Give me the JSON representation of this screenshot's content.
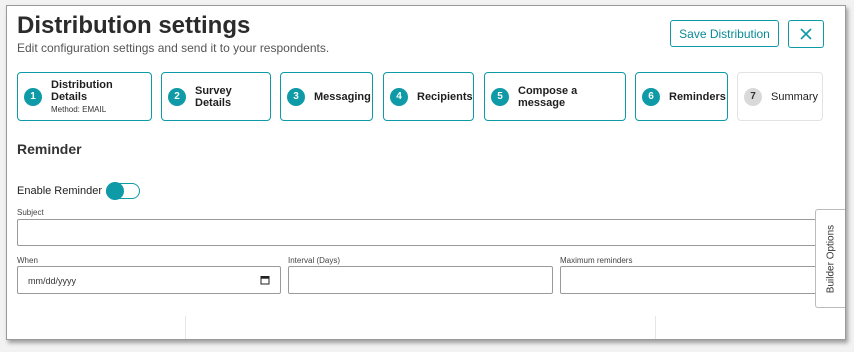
{
  "header": {
    "title": "Distribution settings",
    "subtitle": "Edit configuration settings and send it to your respondents.",
    "save_label": "Save Distribution"
  },
  "steps": [
    {
      "num": "1",
      "label": "Distribution Details",
      "sub": "Method: EMAIL"
    },
    {
      "num": "2",
      "label": "Survey Details"
    },
    {
      "num": "3",
      "label": "Messaging"
    },
    {
      "num": "4",
      "label": "Recipients"
    },
    {
      "num": "5",
      "label": "Compose a message"
    },
    {
      "num": "6",
      "label": "Reminders"
    },
    {
      "num": "7",
      "label": "Summary"
    }
  ],
  "reminder": {
    "section_title": "Reminder",
    "enable_label": "Enable Reminder",
    "enabled": true,
    "subject_label": "Subject",
    "subject_value": "",
    "when_label": "When",
    "when_placeholder": "mm/dd/yyyy",
    "interval_label": "Interval (Days)",
    "interval_value": "",
    "max_label": "Maximum reminders",
    "max_value": ""
  },
  "builder_tab": "Builder Options",
  "colors": {
    "accent": "#0e9aa7",
    "inactive_step": "#d9d9d9"
  }
}
